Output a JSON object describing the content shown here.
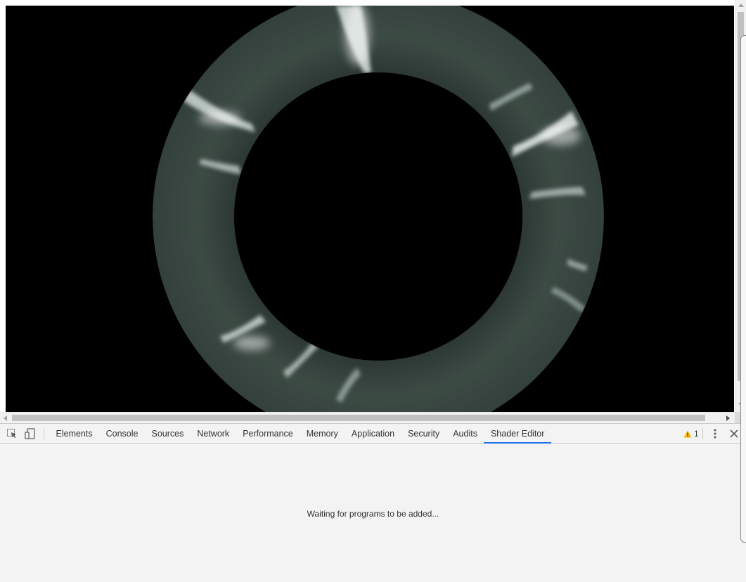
{
  "devtools": {
    "tabs": [
      {
        "label": "Elements",
        "active": false
      },
      {
        "label": "Console",
        "active": false
      },
      {
        "label": "Sources",
        "active": false
      },
      {
        "label": "Network",
        "active": false
      },
      {
        "label": "Performance",
        "active": false
      },
      {
        "label": "Memory",
        "active": false
      },
      {
        "label": "Application",
        "active": false
      },
      {
        "label": "Security",
        "active": false
      },
      {
        "label": "Audits",
        "active": false
      },
      {
        "label": "Shader Editor",
        "active": true
      }
    ],
    "warnings_count": "1",
    "panel_message": "Waiting for programs to be added...",
    "icons": {
      "inspect": "inspect-element-icon",
      "device": "device-toolbar-icon",
      "warning": "warning-icon",
      "menu": "more-vertical-icon",
      "close": "close-icon"
    },
    "colors": {
      "active_tab_underline": "#1a73e8",
      "warning": "#f4b400"
    }
  },
  "page": {
    "canvas_description_colors": {
      "background": "#000000",
      "ring": "#3b4a44"
    }
  }
}
